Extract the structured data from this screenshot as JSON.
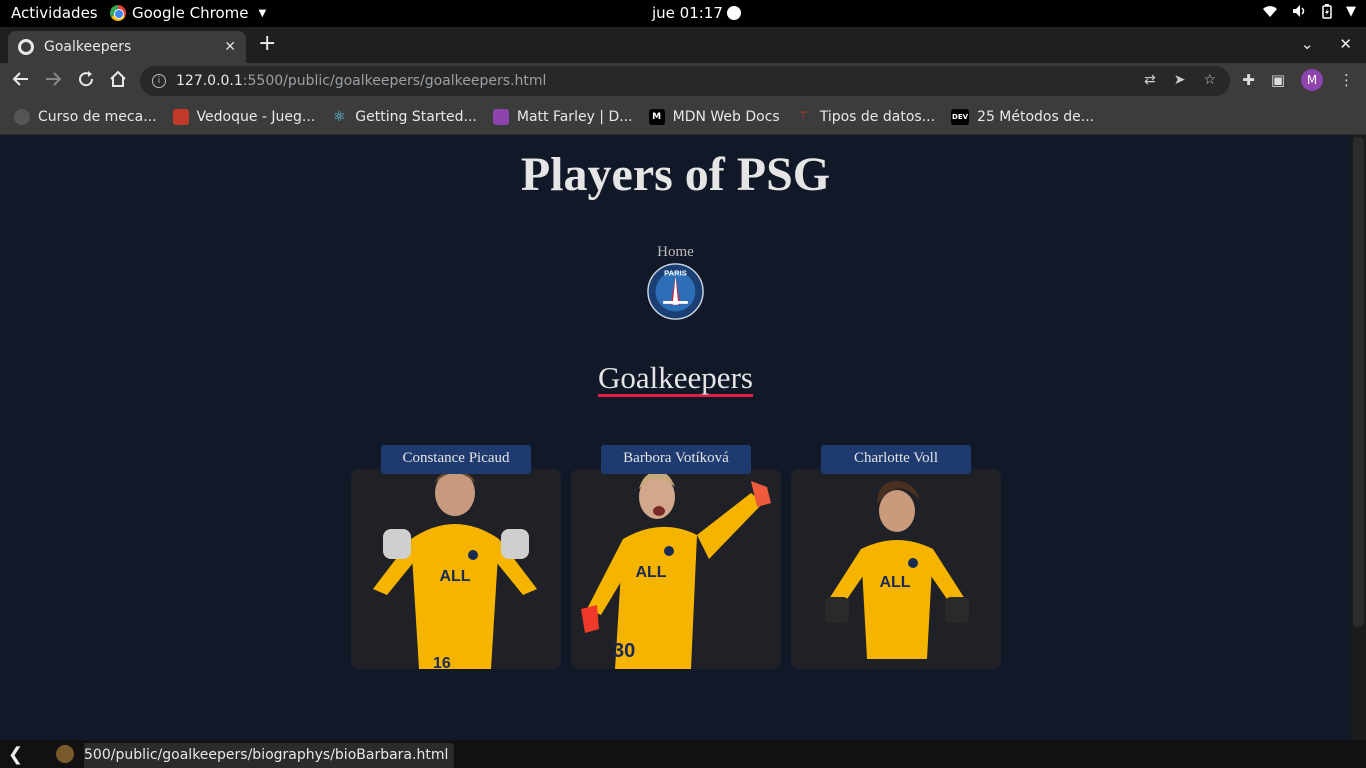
{
  "system_bar": {
    "activities": "Actividades",
    "app_name": "Google Chrome",
    "clock": "jue 01:17"
  },
  "browser": {
    "tab_title": "Goalkeepers",
    "url_host": "127.0.0.1",
    "url_path": ":5500/public/goalkeepers/goalkeepers.html",
    "profile_initial": "M",
    "bookmarks": [
      {
        "label": "Curso de meca...",
        "icon_color": "#555555"
      },
      {
        "label": "Vedoque - Jueg...",
        "icon_color": "#c0392b"
      },
      {
        "label": "Getting Started...",
        "icon_color": "#61dafb"
      },
      {
        "label": "Matt Farley | D...",
        "icon_color": "#8e44ad"
      },
      {
        "label": "MDN Web Docs",
        "icon_color": "#000000"
      },
      {
        "label": "Tipos de datos...",
        "icon_color": "#c0392b"
      },
      {
        "label": "25 Métodos de...",
        "icon_color": "#000000"
      }
    ],
    "status_url": "500/public/goalkeepers/biographys/bioBarbara.html"
  },
  "page": {
    "title": "Players of PSG",
    "home_link": "Home",
    "section_title": "Goalkeepers",
    "players": [
      {
        "name": "Constance Picaud",
        "number": "16"
      },
      {
        "name": "Barbora Votíková",
        "number": "30"
      },
      {
        "name": "Charlotte Voll",
        "number": ""
      }
    ]
  },
  "colors": {
    "page_bg": "#111827",
    "name_tag_bg": "#1e3a6e",
    "underline": "#e11d48",
    "kit": "#f5b400"
  }
}
